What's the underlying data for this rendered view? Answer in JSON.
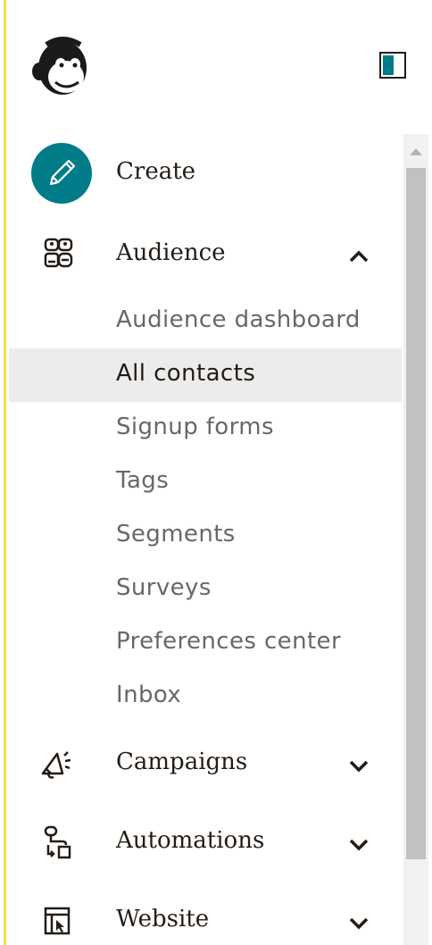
{
  "sidebar": {
    "accent_color": "#f2e14a",
    "create": {
      "label": "Create",
      "icon": "pencil-icon",
      "color": "#007c89"
    },
    "audience": {
      "label": "Audience",
      "icon": "audience-icon",
      "expanded": true,
      "items": [
        {
          "label": "Audience dashboard",
          "active": false
        },
        {
          "label": "All contacts",
          "active": true
        },
        {
          "label": "Signup forms",
          "active": false
        },
        {
          "label": "Tags",
          "active": false
        },
        {
          "label": "Segments",
          "active": false
        },
        {
          "label": "Surveys",
          "active": false
        },
        {
          "label": "Preferences center",
          "active": false
        },
        {
          "label": "Inbox",
          "active": false
        }
      ]
    },
    "campaigns": {
      "label": "Campaigns",
      "icon": "megaphone-icon",
      "expanded": false
    },
    "automations": {
      "label": "Automations",
      "icon": "automations-icon",
      "expanded": false
    },
    "website": {
      "label": "Website",
      "icon": "website-icon",
      "expanded": false
    }
  }
}
